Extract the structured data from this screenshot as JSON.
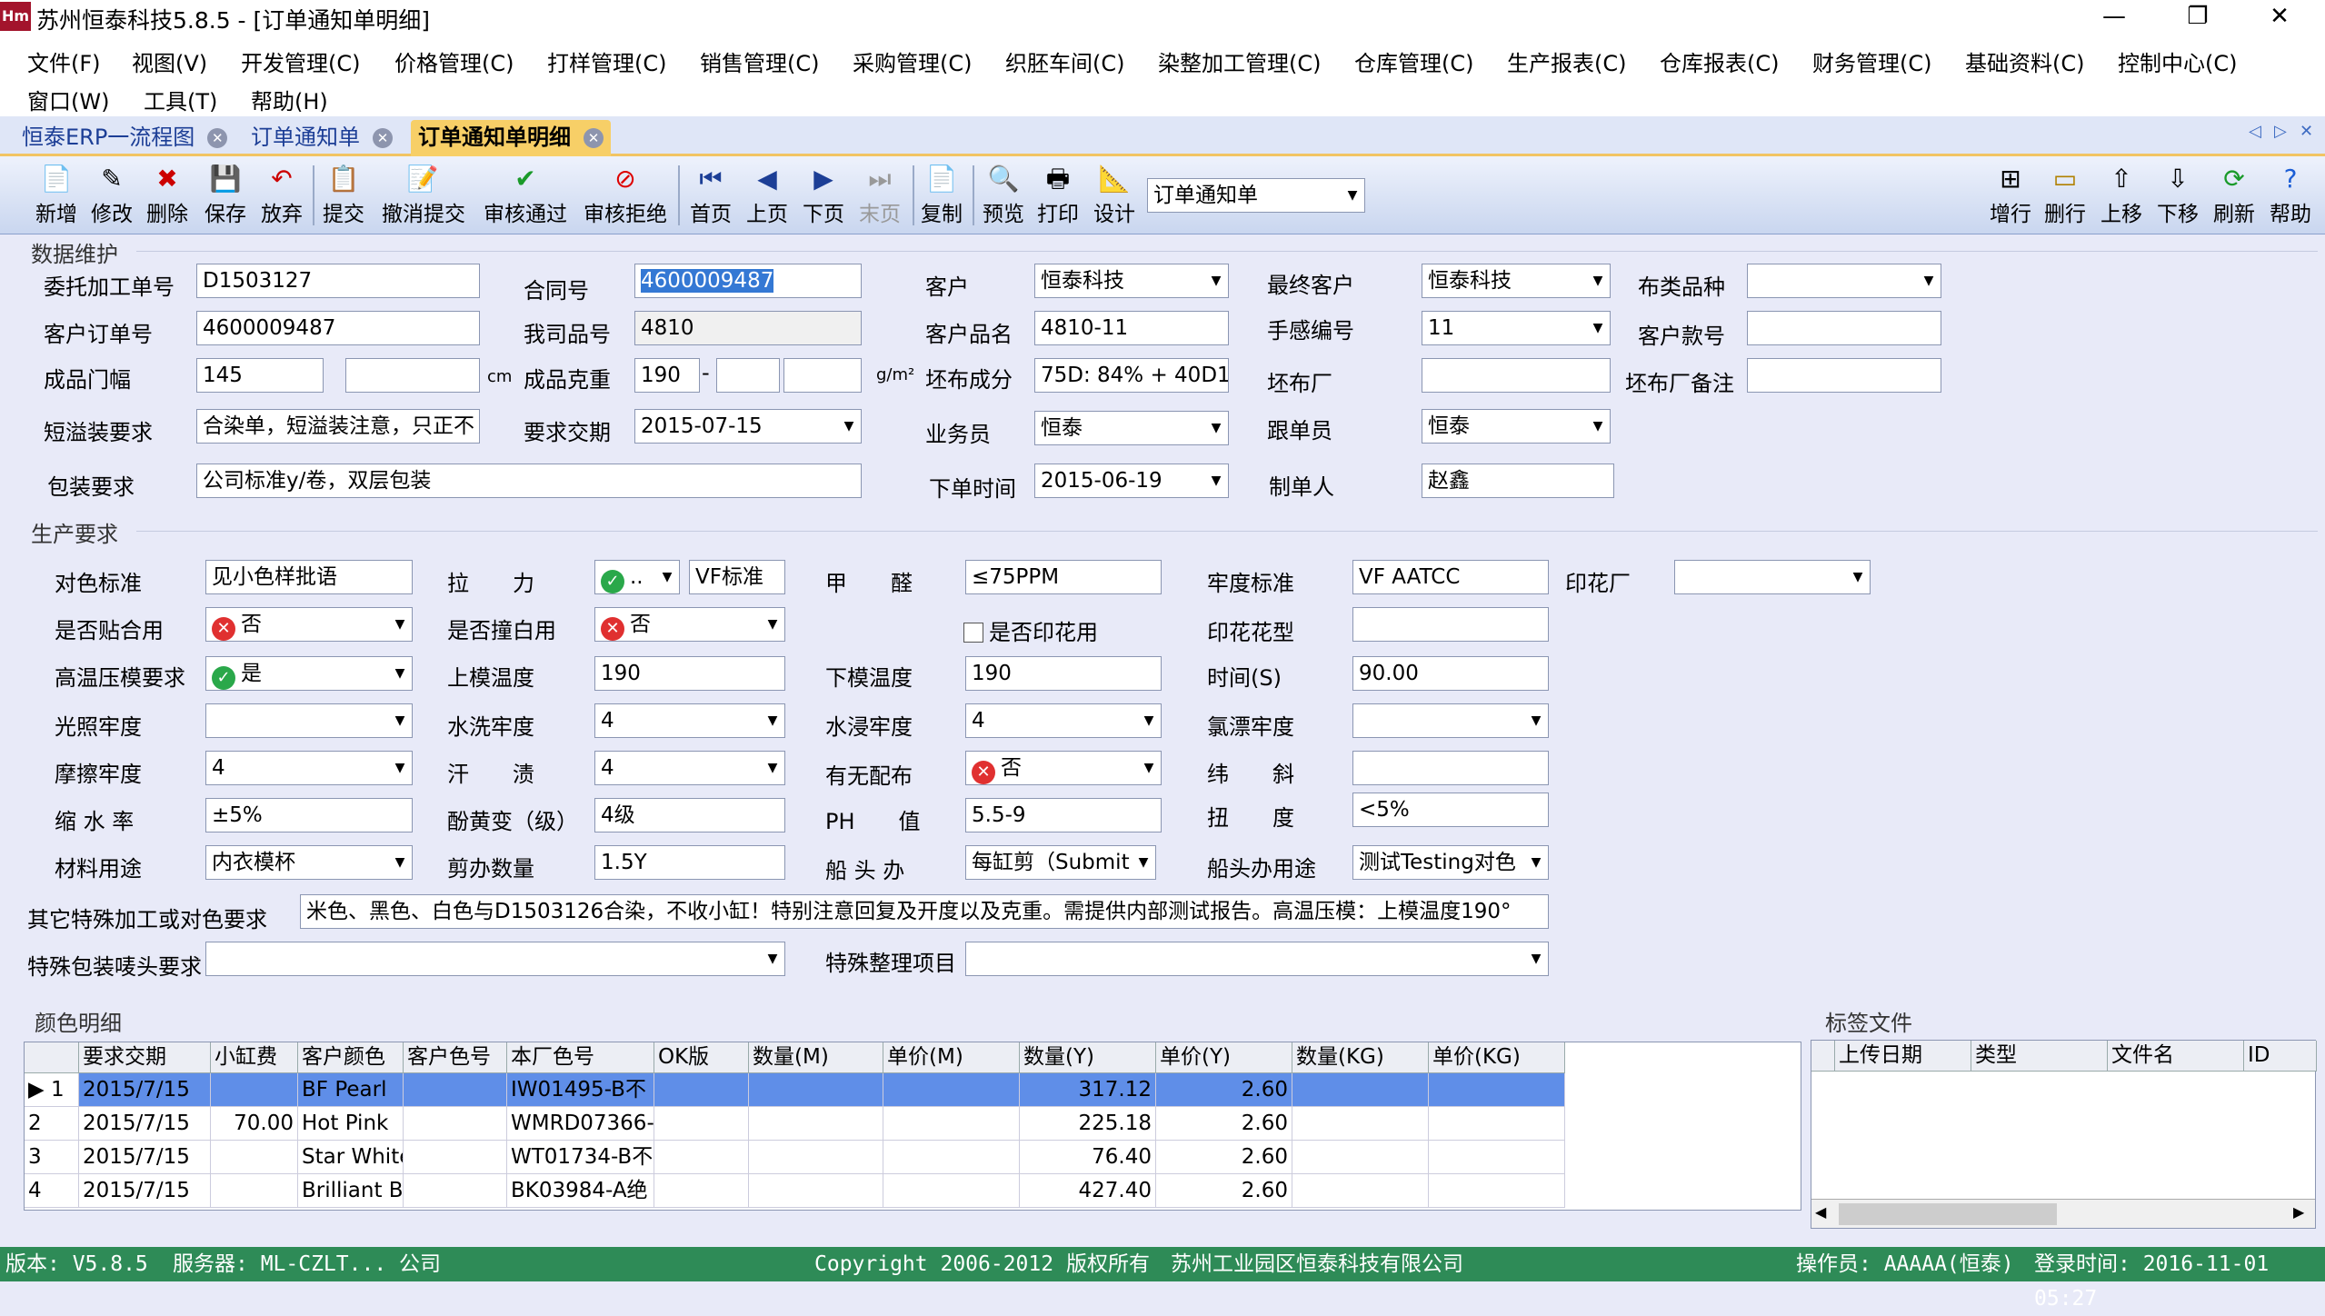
{
  "app": {
    "logo": "Hm",
    "title": "苏州恒泰科技5.8.5 - [订单通知单明细]"
  },
  "window_buttons": {
    "minimize": "—",
    "restore": "❐",
    "close": "✕"
  },
  "menu": [
    "文件(F)",
    "视图(V)",
    "开发管理(C)",
    "价格管理(C)",
    "打样管理(C)",
    "销售管理(C)",
    "采购管理(C)",
    "织胚车间(C)",
    "染整加工管理(C)",
    "仓库管理(C)",
    "生产报表(C)",
    "仓库报表(C)",
    "财务管理(C)",
    "基础资料(C)",
    "控制中心(C)",
    "窗口(W)",
    "工具(T)",
    "帮助(H)"
  ],
  "tabs": [
    {
      "label": "恒泰ERP一流程图"
    },
    {
      "label": "订单通知单"
    },
    {
      "label": "订单通知单明细"
    }
  ],
  "tab_nav": {
    "prev": "◁",
    "next": "▷",
    "close": "✕"
  },
  "toolbar": {
    "left": [
      {
        "label": "新增",
        "icon": "new-icon",
        "glyph": "📄"
      },
      {
        "label": "修改",
        "icon": "edit-icon",
        "glyph": "✎"
      },
      {
        "label": "删除",
        "icon": "delete-icon",
        "glyph": "✖"
      },
      {
        "label": "保存",
        "icon": "save-icon",
        "glyph": "💾"
      },
      {
        "label": "放弃",
        "icon": "discard-icon",
        "glyph": "↶"
      },
      {
        "label": "提交",
        "icon": "submit-icon",
        "glyph": "📋"
      },
      {
        "label": "撤消提交",
        "icon": "revoke-icon",
        "glyph": "📝"
      },
      {
        "label": "审核通过",
        "icon": "approve-icon",
        "glyph": "✔"
      },
      {
        "label": "审核拒绝",
        "icon": "reject-icon",
        "glyph": "⊘"
      },
      {
        "label": "首页",
        "icon": "first-page-icon",
        "glyph": "⏮"
      },
      {
        "label": "上页",
        "icon": "prev-page-icon",
        "glyph": "◀"
      },
      {
        "label": "下页",
        "icon": "next-page-icon",
        "glyph": "▶"
      },
      {
        "label": "末页",
        "icon": "last-page-icon",
        "glyph": "⏭"
      },
      {
        "label": "复制",
        "icon": "copy-icon",
        "glyph": "📄"
      },
      {
        "label": "预览",
        "icon": "preview-icon",
        "glyph": "🔍"
      },
      {
        "label": "打印",
        "icon": "print-icon",
        "glyph": "🖶"
      },
      {
        "label": "设计",
        "icon": "design-icon",
        "glyph": "📐"
      }
    ],
    "report_select": "订单通知单",
    "right": [
      {
        "label": "增行",
        "icon": "add-row-icon",
        "glyph": "⊞"
      },
      {
        "label": "删行",
        "icon": "delete-row-icon",
        "glyph": "▭"
      },
      {
        "label": "上移",
        "icon": "move-up-icon",
        "glyph": "⇧"
      },
      {
        "label": "下移",
        "icon": "move-down-icon",
        "glyph": "⇩"
      },
      {
        "label": "刷新",
        "icon": "refresh-icon",
        "glyph": "⟳"
      },
      {
        "label": "帮助",
        "icon": "help-icon",
        "glyph": "?"
      }
    ]
  },
  "sections": {
    "data": "数据维护",
    "production": "生产要求",
    "colors": "颜色明细",
    "labels": "标签文件"
  },
  "data_fields": {
    "wtjgdh_l": "委托加工单号",
    "wtjgdh": "D1503127",
    "hth_l": "合同号",
    "hth": "4600009487",
    "kh_l": "客户",
    "kh": "恒泰科技",
    "zzkh_l": "最终客户",
    "zzkh": "恒泰科技",
    "blpz_l": "布类品种",
    "blpz": "",
    "khddh_l": "客户订单号",
    "khddh": "4600009487",
    "wspm_l": "我司品号",
    "wspm": "4810",
    "khpm_l": "客户品名",
    "khpm": "4810-11",
    "sgbh_l": "手感编号",
    "sgbh": "11",
    "khkh_l": "客户款号",
    "khkh": "",
    "cpmf_l": "成品门幅",
    "cpmf": "145",
    "cpmf2": "",
    "unit_cm": "cm",
    "cpkz_l": "成品克重",
    "cpkz": "190",
    "cpkz_dash": "-",
    "cpkz2": "",
    "cpkz3": "",
    "unit_gm": "g/m²",
    "pbcf_l": "坯布成分",
    "pbcf": "75D: 84% + 40D1",
    "pbc_l": "坯布厂",
    "pbc": "",
    "pbcbz_l": "坯布厂备注",
    "pbcbz": "",
    "dyzyq_l": "短溢装要求",
    "dyzyq": "合染单，短溢装注意，只正不",
    "yqjq_l": "要求交期",
    "yqjq": "2015-07-15",
    "ywy_l": "业务员",
    "ywy": "恒泰",
    "gdy_l": "跟单员",
    "gdy": "恒泰",
    "bzyq_l": "包装要求",
    "bzyq": "公司标准y/卷，双层包装",
    "xdsj_l": "下单时间",
    "xdsj": "2015-06-19",
    "zdr_l": "制单人",
    "zdr": "赵鑫"
  },
  "prod": {
    "dsbz_l": "对色标准",
    "dsbz": "见小色样批语",
    "ll_l": "拉　　力",
    "ll": "..",
    "ll2": "VF标准",
    "jq_l": "甲　　醛",
    "jq": "≤75PPM",
    "ldbz_l": "牢度标准",
    "ldbz": "VF AATCC",
    "yhc_l": "印花厂",
    "yhc": "",
    "sftzh_l": "是否贴合用",
    "sftzh": "否",
    "sfzby_l": "是否撞白用",
    "sfzby": "否",
    "sfyhy_l": "是否印花用",
    "yhhx_l": "印花花型",
    "yhhx": "",
    "gwym_l": "高温压模要求",
    "gwym": "是",
    "smwd_l": "上模温度",
    "smwd": "190",
    "xmwd_l": "下模温度",
    "xmwd": "190",
    "sj_l": "时间(S)",
    "sj": "90.00",
    "gzld_l": "光照牢度",
    "gzld": "",
    "sxld_l": "水洗牢度",
    "sxld": "4",
    "sjld_l": "水浸牢度",
    "sjld": "4",
    "lpld_l": "氯漂牢度",
    "lpld": "",
    "mcld_l": "摩擦牢度",
    "mcld": "4",
    "hz_l": "汗　　渍",
    "hz": "4",
    "ywpb_l": "有无配布",
    "ywpb": "否",
    "wx_l": "纬　　斜",
    "wx": "",
    "ssl_l": "缩 水 率",
    "ssl": "±5%",
    "fhb_l": "酚黄变（级）",
    "fhb": "4级",
    "ph_l": "PH　　值",
    "ph": "5.5-9",
    "nd_l": "扭　　度",
    "nd": "<5%",
    "clyt_l": "材料用途",
    "clyt": "内衣模杯",
    "jbsl_l": "剪办数量",
    "jbsl": "1.5Y",
    "ctb_l": "船 头 办",
    "ctb": "每缸剪（Submit",
    "ctbyt_l": "船头办用途",
    "ctbyt": "测试Testing对色",
    "qtts_l": "其它特殊加工或对色要求",
    "qtts": "米色、黑色、白色与D1503126合染，不收小缸！特别注意回复及开度以及克重。需提供内部测试报告。高温压模：上模温度190°",
    "tsbz_l": "特殊包装唛头要求",
    "tsbz": "",
    "tszl_l": "特殊整理项目",
    "tszl": ""
  },
  "color_grid": {
    "headers": [
      "要求交期",
      "小缸费",
      "客户颜色",
      "客户色号",
      "本厂色号",
      "OK版",
      "数量(M)",
      "单价(M)",
      "数量(Y)",
      "单价(Y)",
      "数量(KG)",
      "单价(KG)"
    ],
    "rows": [
      {
        "n": "1",
        "c": [
          "2015/7/15",
          "",
          "BF Pearl",
          "",
          "IW01495-B不",
          "",
          "",
          "",
          "317.12",
          "2.60",
          "",
          ""
        ]
      },
      {
        "n": "2",
        "c": [
          "2015/7/15",
          "70.00",
          "Hot Pink",
          "",
          "WMRD07366-",
          "",
          "",
          "",
          "225.18",
          "2.60",
          "",
          ""
        ]
      },
      {
        "n": "3",
        "c": [
          "2015/7/15",
          "",
          "Star White",
          "",
          "WT01734-B不",
          "",
          "",
          "",
          "76.40",
          "2.60",
          "",
          ""
        ]
      },
      {
        "n": "4",
        "c": [
          "2015/7/15",
          "",
          "Brilliant Blue",
          "",
          "BK03984-A绝",
          "",
          "",
          "",
          "427.40",
          "2.60",
          "",
          ""
        ]
      }
    ]
  },
  "label_grid": {
    "headers": [
      "上传日期",
      "类型",
      "文件名",
      "ID"
    ]
  },
  "status": {
    "version": "版本: V5.8.5",
    "server": "服务器: ML-CZLT... 公司",
    "copyright": "Copyright 2006-2012 版权所有　苏州工业园区恒泰科技有限公司",
    "operator": "操作员: AAAAA(恒泰)",
    "login": "登录时间: 2016-11-01 05:27"
  }
}
